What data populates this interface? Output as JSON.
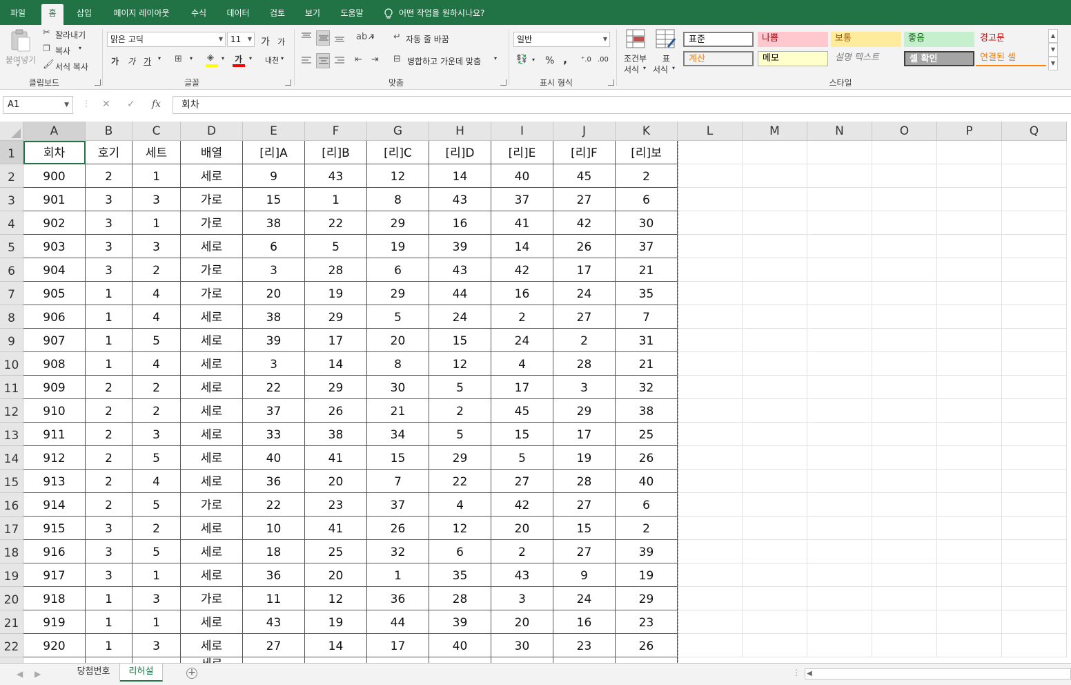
{
  "menu": {
    "tabs": [
      {
        "label": "파일",
        "name": "tab-file"
      },
      {
        "label": "홈",
        "name": "tab-home",
        "active": true
      },
      {
        "label": "삽입",
        "name": "tab-insert"
      },
      {
        "label": "페이지 레이아웃",
        "name": "tab-page-layout"
      },
      {
        "label": "수식",
        "name": "tab-formulas"
      },
      {
        "label": "데이터",
        "name": "tab-data"
      },
      {
        "label": "검토",
        "name": "tab-review"
      },
      {
        "label": "보기",
        "name": "tab-view"
      },
      {
        "label": "도움말",
        "name": "tab-help"
      }
    ],
    "tell_me": "어떤 작업을 원하시나요?"
  },
  "ribbon": {
    "clipboard": {
      "paste": "붙여넣기",
      "cut": "잘라내기",
      "copy": "복사",
      "format_painter": "서식 복사",
      "group_label": "클립보드"
    },
    "font": {
      "font_name": "맑은 고딕",
      "font_size": "11",
      "grow": "가",
      "shrink": "가",
      "bold": "가",
      "italic": "가",
      "underline": "가",
      "strike": "가",
      "phonetic": "내천",
      "group_label": "글꼴"
    },
    "alignment": {
      "wrap_text": "자동 줄 바꿈",
      "merge_center": "병합하고 가운데 맞춤",
      "group_label": "맞춤"
    },
    "number": {
      "format": "일반",
      "percent": "%",
      "comma": ",",
      "group_label": "표시 형식"
    },
    "conditional": {
      "line1": "조건부",
      "line2": "서식"
    },
    "table_format": {
      "line1": "표",
      "line2": "서식"
    },
    "styles": {
      "items": [
        {
          "label": "표준",
          "bg": "#ffffff",
          "color": "#000000"
        },
        {
          "label": "나쁨",
          "bg": "#ffc7ce",
          "color": "#9c0006"
        },
        {
          "label": "보통",
          "bg": "#ffeb9c",
          "color": "#9c5700"
        },
        {
          "label": "좋음",
          "bg": "#c6efce",
          "color": "#006100"
        },
        {
          "label": "경고문",
          "bg": "#f3f3f3",
          "color": "#c00000"
        },
        {
          "label": "계산",
          "bg": "#f2f2f2",
          "color": "#fa7d00"
        },
        {
          "label": "메모",
          "bg": "#ffffcc",
          "color": "#000000"
        },
        {
          "label": "설명 텍스트",
          "bg": "#f3f3f3",
          "color": "#7f7f7f"
        },
        {
          "label": "셀 확인",
          "bg": "#a5a5a5",
          "color": "#ffffff"
        },
        {
          "label": "연결된 셀",
          "bg": "#f3f3f3",
          "color": "#fa7d00"
        }
      ],
      "group_label": "스타일"
    }
  },
  "formula_bar": {
    "name_box": "A1",
    "content": "회차"
  },
  "sheet": {
    "columns": [
      "A",
      "B",
      "C",
      "D",
      "E",
      "F",
      "G",
      "H",
      "I",
      "J",
      "K",
      "L",
      "M",
      "N",
      "O",
      "P",
      "Q"
    ],
    "row_numbers": [
      "1",
      "2",
      "3",
      "4",
      "5",
      "6",
      "7",
      "8",
      "9",
      "10",
      "11",
      "12",
      "13",
      "14",
      "15",
      "16",
      "17",
      "18",
      "19",
      "20",
      "21",
      "22"
    ],
    "header_row": [
      "회차",
      "호기",
      "세트",
      "배열",
      "[리]A",
      "[리]B",
      "[리]C",
      "[리]D",
      "[리]E",
      "[리]F",
      "[리]보"
    ],
    "rows": [
      [
        "900",
        "2",
        "1",
        "세로",
        "9",
        "43",
        "12",
        "14",
        "40",
        "45",
        "2"
      ],
      [
        "901",
        "3",
        "3",
        "가로",
        "15",
        "1",
        "8",
        "43",
        "37",
        "27",
        "6"
      ],
      [
        "902",
        "3",
        "1",
        "가로",
        "38",
        "22",
        "29",
        "16",
        "41",
        "42",
        "30"
      ],
      [
        "903",
        "3",
        "3",
        "세로",
        "6",
        "5",
        "19",
        "39",
        "14",
        "26",
        "37"
      ],
      [
        "904",
        "3",
        "2",
        "가로",
        "3",
        "28",
        "6",
        "43",
        "42",
        "17",
        "21"
      ],
      [
        "905",
        "1",
        "4",
        "가로",
        "20",
        "19",
        "29",
        "44",
        "16",
        "24",
        "35"
      ],
      [
        "906",
        "1",
        "4",
        "세로",
        "38",
        "29",
        "5",
        "24",
        "2",
        "27",
        "7"
      ],
      [
        "907",
        "1",
        "5",
        "세로",
        "39",
        "17",
        "20",
        "15",
        "24",
        "2",
        "31"
      ],
      [
        "908",
        "1",
        "4",
        "세로",
        "3",
        "14",
        "8",
        "12",
        "4",
        "28",
        "21"
      ],
      [
        "909",
        "2",
        "2",
        "세로",
        "22",
        "29",
        "30",
        "5",
        "17",
        "3",
        "32"
      ],
      [
        "910",
        "2",
        "2",
        "세로",
        "37",
        "26",
        "21",
        "2",
        "45",
        "29",
        "38"
      ],
      [
        "911",
        "2",
        "3",
        "세로",
        "33",
        "38",
        "34",
        "5",
        "15",
        "17",
        "25"
      ],
      [
        "912",
        "2",
        "5",
        "세로",
        "40",
        "41",
        "15",
        "29",
        "5",
        "19",
        "26"
      ],
      [
        "913",
        "2",
        "4",
        "세로",
        "36",
        "20",
        "7",
        "22",
        "27",
        "28",
        "40"
      ],
      [
        "914",
        "2",
        "5",
        "가로",
        "22",
        "23",
        "37",
        "4",
        "42",
        "27",
        "6"
      ],
      [
        "915",
        "3",
        "2",
        "세로",
        "10",
        "41",
        "26",
        "12",
        "20",
        "15",
        "2"
      ],
      [
        "916",
        "3",
        "5",
        "세로",
        "18",
        "25",
        "32",
        "6",
        "2",
        "27",
        "39"
      ],
      [
        "917",
        "3",
        "1",
        "세로",
        "36",
        "20",
        "1",
        "35",
        "43",
        "9",
        "19"
      ],
      [
        "918",
        "1",
        "3",
        "가로",
        "11",
        "12",
        "36",
        "28",
        "3",
        "24",
        "29"
      ],
      [
        "919",
        "1",
        "1",
        "세로",
        "43",
        "19",
        "44",
        "39",
        "20",
        "16",
        "23"
      ],
      [
        "920",
        "1",
        "3",
        "세로",
        "27",
        "14",
        "17",
        "40",
        "30",
        "23",
        "26"
      ]
    ],
    "partial_row_label": "세로"
  },
  "sheet_tabs": [
    {
      "label": "당첨번호",
      "active": false
    },
    {
      "label": "리허설",
      "active": true
    }
  ],
  "colors": {
    "accent": "#217346",
    "grid_line": "#e1e1e1",
    "data_border": "#555555"
  }
}
